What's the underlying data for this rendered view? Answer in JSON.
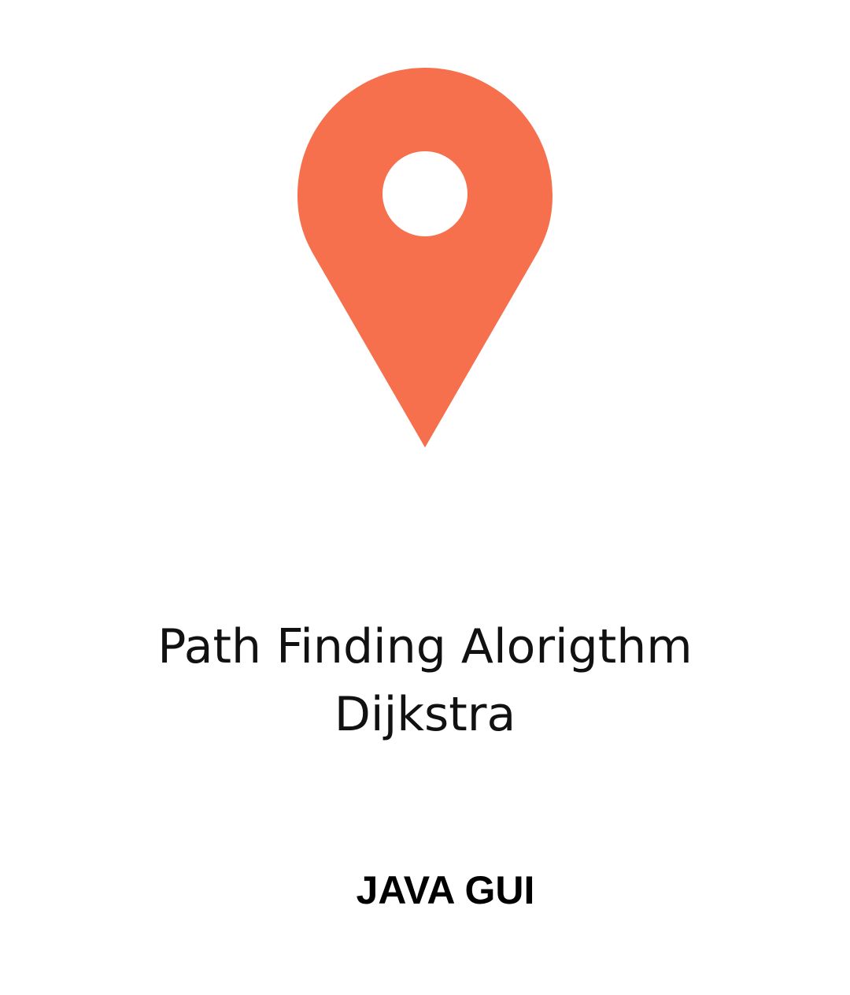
{
  "icon": {
    "name": "location-pin-icon",
    "color": "#F6704D",
    "hole_color": "#FFFFFF"
  },
  "title": {
    "line1": "Path Finding Alorigthm",
    "line2": "Dijkstra"
  },
  "subtitle": "JAVA GUI",
  "background": "#FFFFFF"
}
